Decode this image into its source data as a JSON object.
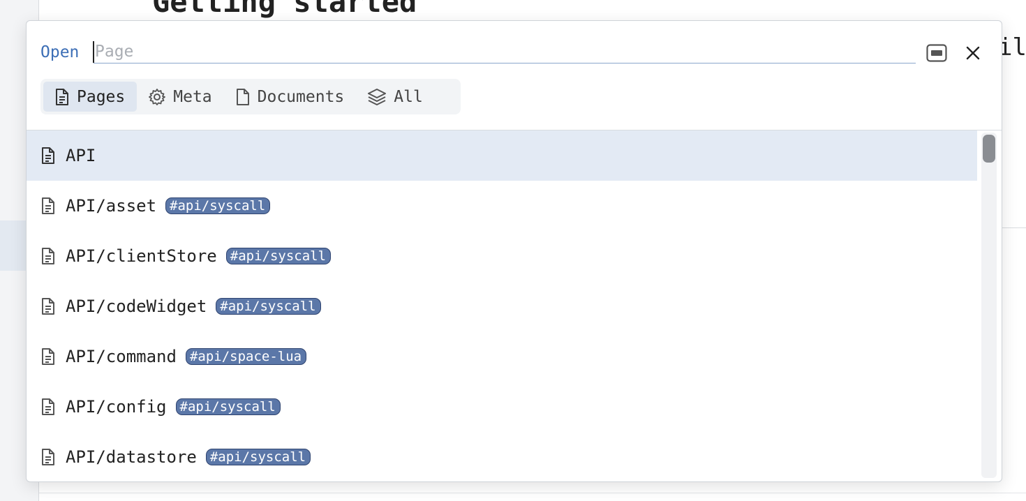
{
  "background": {
    "heading": "Getting started",
    "trail_text": "il"
  },
  "picker": {
    "prompt_label": "Open",
    "placeholder": "Page",
    "value": "",
    "filters": [
      {
        "label": "Pages",
        "icon": "file-text-icon",
        "active": true
      },
      {
        "label": "Meta",
        "icon": "gear-icon",
        "active": false
      },
      {
        "label": "Documents",
        "icon": "file-icon",
        "active": false
      },
      {
        "label": "All",
        "icon": "layers-icon",
        "active": false
      }
    ],
    "results": [
      {
        "title": "API",
        "tag": "",
        "selected": true
      },
      {
        "title": "API/asset",
        "tag": "#api/syscall"
      },
      {
        "title": "API/clientStore",
        "tag": "#api/syscall"
      },
      {
        "title": "API/codeWidget",
        "tag": "#api/syscall"
      },
      {
        "title": "API/command",
        "tag": "#api/space-lua"
      },
      {
        "title": "API/config",
        "tag": "#api/syscall"
      },
      {
        "title": "API/datastore",
        "tag": "#api/syscall"
      }
    ]
  },
  "colors": {
    "accent": "#3d6fb6",
    "selected_row": "#e3eaf4",
    "tag_bg": "#5b77a8"
  }
}
